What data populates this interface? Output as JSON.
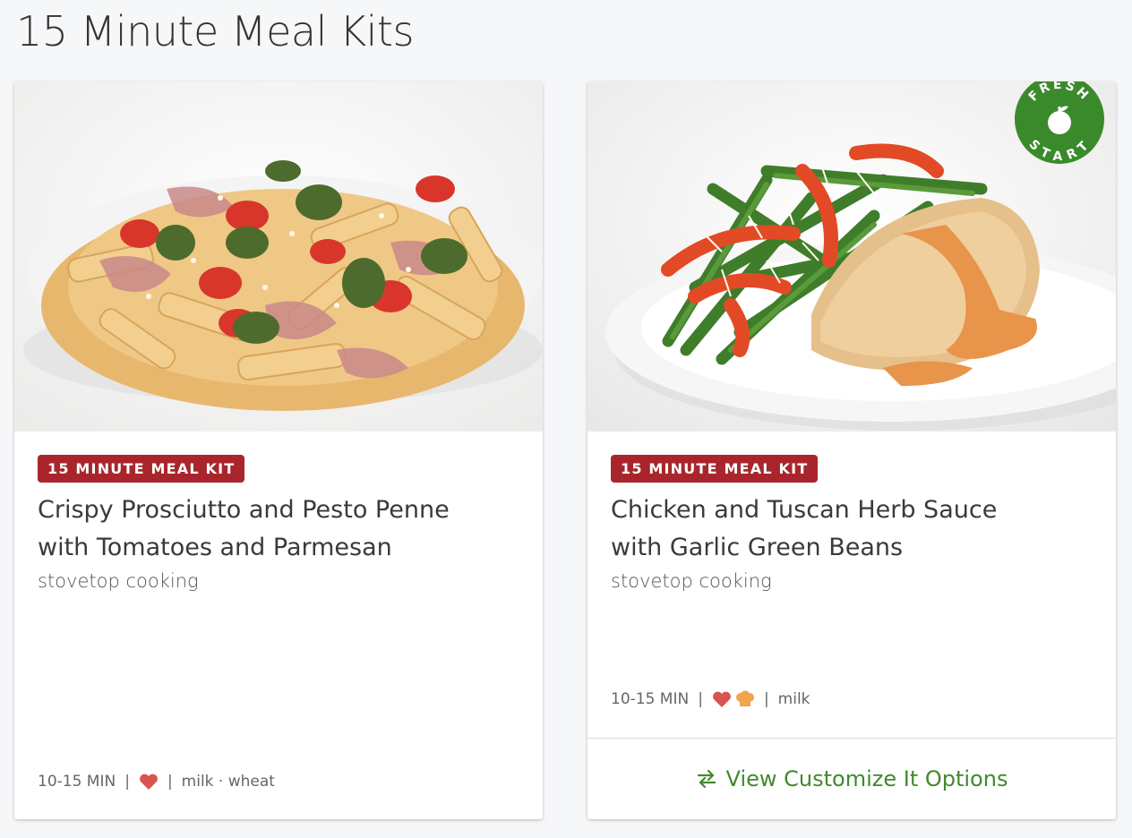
{
  "page": {
    "title": "15 Minute Meal Kits"
  },
  "colors": {
    "badge": "#a8262b",
    "link": "#3f8a2b",
    "heart": "#d9534f",
    "chef_hat": "#f0a44e",
    "fresh_start": "#3a8a2c"
  },
  "cards": [
    {
      "badge": "15 MINUTE MEAL KIT",
      "title_line1": "Crispy Prosciutto and Pesto Penne",
      "title_line2": "with Tomatoes and Parmesan",
      "subtitle": "stovetop cooking",
      "time": "10-15 MIN",
      "sep": "|",
      "icons": [
        "heart-icon"
      ],
      "allergens": "milk · wheat"
    },
    {
      "badge": "15 MINUTE MEAL KIT",
      "title_line1": "Chicken and Tuscan Herb Sauce",
      "title_line2": "with Garlic Green Beans",
      "subtitle": "stovetop cooking",
      "time": "10-15 MIN",
      "sep": "|",
      "icons": [
        "heart-icon",
        "chef-hat-icon"
      ],
      "allergens": "milk",
      "fresh_badge": {
        "top": "FRESH",
        "bottom": "START"
      },
      "customize_label": "View Customize It Options"
    }
  ]
}
